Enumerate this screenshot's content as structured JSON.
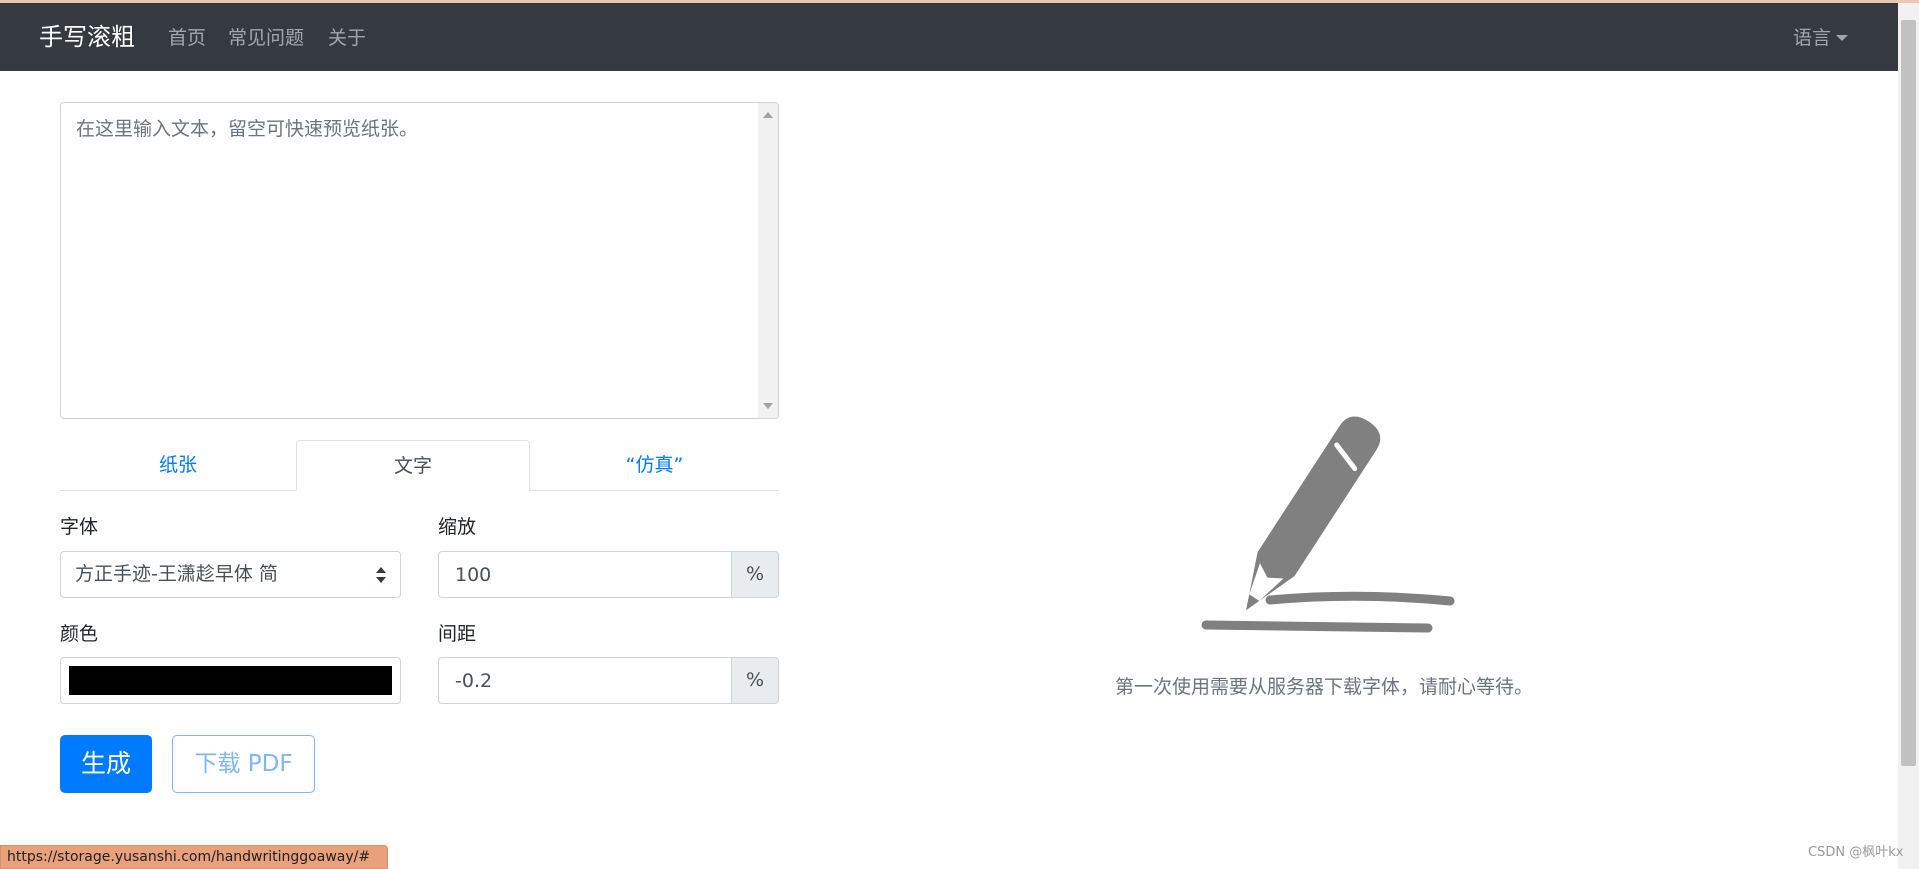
{
  "navbar": {
    "brand": "手写滚粗",
    "links": [
      "首页",
      "常见问题",
      "关于"
    ],
    "language": "语言"
  },
  "editor": {
    "placeholder": "在这里输入文本，留空可快速预览纸张。"
  },
  "tabs": [
    {
      "label": "纸张",
      "active": false
    },
    {
      "label": "文字",
      "active": true
    },
    {
      "label": "“仿真”",
      "active": false
    }
  ],
  "form": {
    "font_label": "字体",
    "font_value": "方正手迹-王潇趁早体 简",
    "scale_label": "缩放",
    "scale_value": "100",
    "scale_unit": "%",
    "color_label": "颜色",
    "color_value": "#000000",
    "spacing_label": "间距",
    "spacing_value": "-0.2",
    "spacing_unit": "%"
  },
  "buttons": {
    "generate": "生成",
    "download": "下载 PDF"
  },
  "preview": {
    "icon": "pen-icon",
    "message": "第一次使用需要从服务器下载字体，请耐心等待。"
  },
  "status_bar": {
    "url": "https://storage.yusanshi.com/handwritinggoaway/#"
  },
  "watermark": "CSDN @枫叶kx",
  "colors": {
    "navbar_bg": "#343a40",
    "primary": "#007bff",
    "icon_gray": "#808080"
  }
}
